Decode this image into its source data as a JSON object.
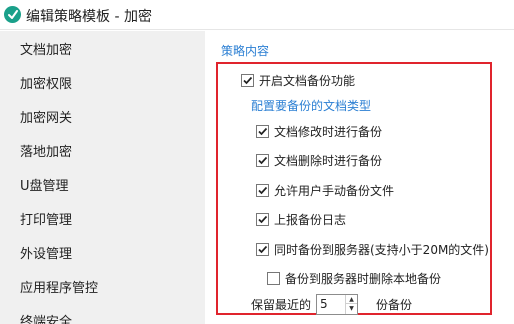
{
  "window": {
    "title": "编辑策略模板 - 加密"
  },
  "sidebar": {
    "items": [
      {
        "label": "文档加密"
      },
      {
        "label": "加密权限"
      },
      {
        "label": "加密网关"
      },
      {
        "label": "落地加密"
      },
      {
        "label": "U盘管理"
      },
      {
        "label": "打印管理"
      },
      {
        "label": "外设管理"
      },
      {
        "label": "应用程序管控"
      },
      {
        "label": "终端安全"
      }
    ]
  },
  "main": {
    "section_title": "策略内容",
    "enable_backup": {
      "label": "开启文档备份功能",
      "checked": true
    },
    "types_heading": "配置要备份的文档类型",
    "options": [
      {
        "label": "文档修改时进行备份",
        "checked": true
      },
      {
        "label": "文档删除时进行备份",
        "checked": true
      },
      {
        "label": "允许用户手动备份文件",
        "checked": true
      },
      {
        "label": "上报备份日志",
        "checked": true
      },
      {
        "label": "同时备份到服务器(支持小于20M的文件)",
        "checked": true
      }
    ],
    "delete_local": {
      "label": "备份到服务器时删除本地备份",
      "checked": false
    },
    "keep_recent": {
      "prefix": "保留最近的",
      "value": "5",
      "suffix": "份备份"
    }
  },
  "colors": {
    "accent": "#2b7fd3",
    "highlight_border": "#e0242d",
    "sidebar_bg": "#f0f0f0",
    "app_icon": "#1aa08a"
  }
}
